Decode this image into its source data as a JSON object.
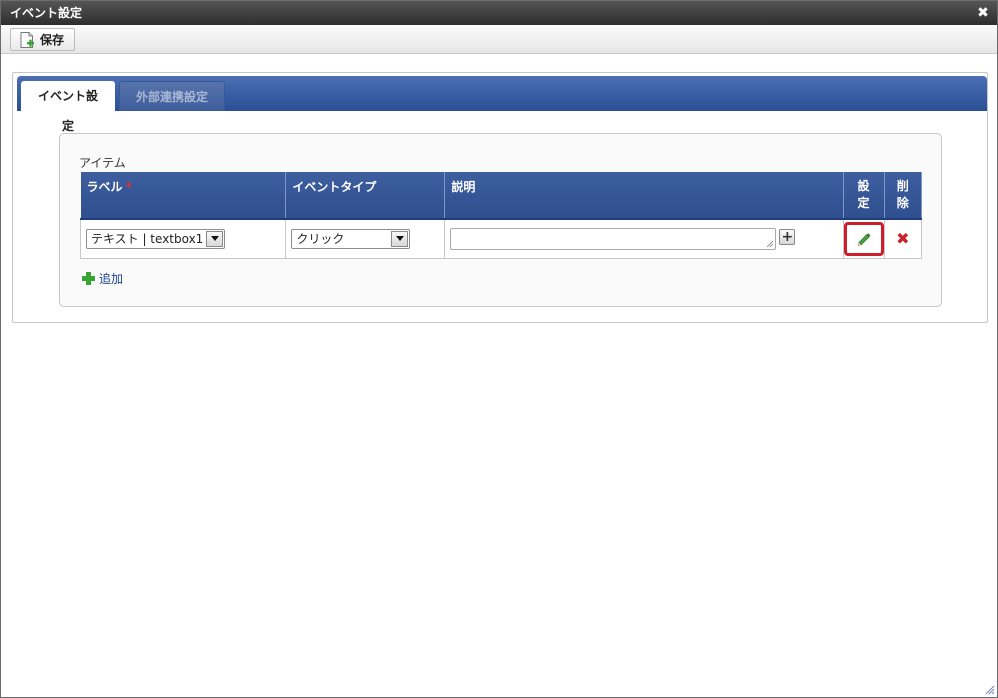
{
  "window": {
    "title": "イベント設定"
  },
  "toolbar": {
    "save_label": "保存"
  },
  "tabs": [
    {
      "label": "イベント設定",
      "active": true
    },
    {
      "label": "外部連携設定",
      "active": false
    }
  ],
  "section": {
    "legend": "アイテム"
  },
  "table": {
    "headers": {
      "label": "ラベル",
      "required_mark": "*",
      "event_type": "イベントタイプ",
      "description": "説明",
      "settings": "設定",
      "delete": "削除"
    },
    "rows": [
      {
        "label_value": "テキスト | textbox1",
        "event_type_value": "クリック",
        "description_value": ""
      }
    ]
  },
  "actions": {
    "add_label": "追加"
  },
  "colors": {
    "header_blue": "#2f4f8f",
    "highlight_red": "#cc1f2b",
    "delete_red": "#c8232c",
    "add_green": "#3aa335"
  }
}
